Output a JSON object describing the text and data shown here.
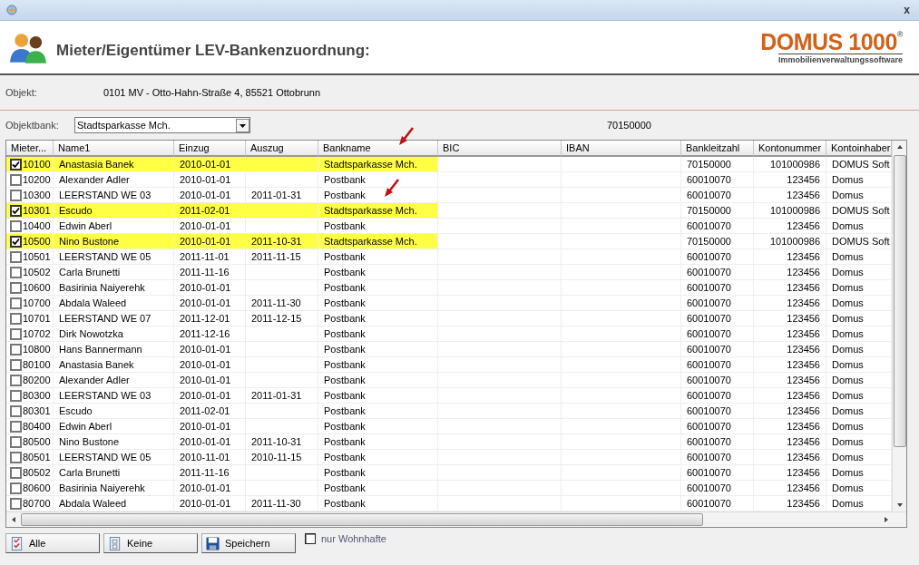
{
  "window": {
    "close": "x"
  },
  "header": {
    "title": "Mieter/Eigentümer LEV-Bankenzuordnung:",
    "logo": {
      "name": "DOMUS 1000",
      "mark": "®",
      "tagline": "Immobilienverwaltungssoftware"
    }
  },
  "objekt": {
    "label": "Objekt:",
    "value": "0101 MV - Otto-Hahn-Straße 4, 85521 Ottobrunn"
  },
  "objektbank": {
    "label": "Objektbank:",
    "value": "Stadtsparkasse Mch.",
    "bankleitzahl": "70150000"
  },
  "table": {
    "columns": [
      "Mieter...",
      "Name1",
      "Einzug",
      "Auszug",
      "Bankname",
      "BIC",
      "IBAN",
      "Bankleitzahl",
      "Kontonummer",
      "Kontoinhaber"
    ],
    "rows": [
      {
        "checked": true,
        "mieter": "10100",
        "name1": "Anastasia Banek",
        "einzug": "2010-01-01",
        "bankname": "Stadtsparkasse Mch.",
        "bankleitzahl": "70150000",
        "kontonummer": "101000986",
        "kontoinhaber": "DOMUS Soft"
      },
      {
        "checked": false,
        "mieter": "10200",
        "name1": "Alexander Adler",
        "einzug": "2010-01-01",
        "bankname": "Postbank",
        "bankleitzahl": "60010070",
        "kontonummer": "123456",
        "kontoinhaber": "Domus"
      },
      {
        "checked": false,
        "mieter": "10300",
        "name1": "LEERSTAND WE 03",
        "einzug": "2010-01-01",
        "auszug": "2011-01-31",
        "bankname": "Postbank",
        "bankleitzahl": "60010070",
        "kontonummer": "123456",
        "kontoinhaber": "Domus"
      },
      {
        "checked": true,
        "mieter": "10301",
        "name1": "Escudo",
        "einzug": "2011-02-01",
        "bankname": "Stadtsparkasse Mch.",
        "bankleitzahl": "70150000",
        "kontonummer": "101000986",
        "kontoinhaber": "DOMUS Soft"
      },
      {
        "checked": false,
        "mieter": "10400",
        "name1": "Edwin Aberl",
        "einzug": "2010-01-01",
        "bankname": "Postbank",
        "bankleitzahl": "60010070",
        "kontonummer": "123456",
        "kontoinhaber": "Domus"
      },
      {
        "checked": true,
        "mieter": "10500",
        "name1": "Nino Bustone",
        "einzug": "2010-01-01",
        "auszug": "2011-10-31",
        "bankname": "Stadtsparkasse Mch.",
        "bankleitzahl": "70150000",
        "kontonummer": "101000986",
        "kontoinhaber": "DOMUS Soft"
      },
      {
        "checked": false,
        "mieter": "10501",
        "name1": "LEERSTAND WE 05",
        "einzug": "2011-11-01",
        "auszug": "2011-11-15",
        "bankname": "Postbank",
        "bankleitzahl": "60010070",
        "kontonummer": "123456",
        "kontoinhaber": "Domus"
      },
      {
        "checked": false,
        "mieter": "10502",
        "name1": "Carla Brunetti",
        "einzug": "2011-11-16",
        "bankname": "Postbank",
        "bankleitzahl": "60010070",
        "kontonummer": "123456",
        "kontoinhaber": "Domus"
      },
      {
        "checked": false,
        "mieter": "10600",
        "name1": "Basirinia Naiyerehk",
        "einzug": "2010-01-01",
        "bankname": "Postbank",
        "bankleitzahl": "60010070",
        "kontonummer": "123456",
        "kontoinhaber": "Domus"
      },
      {
        "checked": false,
        "mieter": "10700",
        "name1": "Abdala Waleed",
        "einzug": "2010-01-01",
        "auszug": "2011-11-30",
        "bankname": "Postbank",
        "bankleitzahl": "60010070",
        "kontonummer": "123456",
        "kontoinhaber": "Domus"
      },
      {
        "checked": false,
        "mieter": "10701",
        "name1": "LEERSTAND WE 07",
        "einzug": "2011-12-01",
        "auszug": "2011-12-15",
        "bankname": "Postbank",
        "bankleitzahl": "60010070",
        "kontonummer": "123456",
        "kontoinhaber": "Domus"
      },
      {
        "checked": false,
        "mieter": "10702",
        "name1": "Dirk Nowotzka",
        "einzug": "2011-12-16",
        "bankname": "Postbank",
        "bankleitzahl": "60010070",
        "kontonummer": "123456",
        "kontoinhaber": "Domus"
      },
      {
        "checked": false,
        "mieter": "10800",
        "name1": "Hans Bannermann",
        "einzug": "2010-01-01",
        "bankname": "Postbank",
        "bankleitzahl": "60010070",
        "kontonummer": "123456",
        "kontoinhaber": "Domus"
      },
      {
        "checked": false,
        "mieter": "80100",
        "name1": "Anastasia Banek",
        "einzug": "2010-01-01",
        "bankname": "Postbank",
        "bankleitzahl": "60010070",
        "kontonummer": "123456",
        "kontoinhaber": "Domus"
      },
      {
        "checked": false,
        "mieter": "80200",
        "name1": "Alexander Adler",
        "einzug": "2010-01-01",
        "bankname": "Postbank",
        "bankleitzahl": "60010070",
        "kontonummer": "123456",
        "kontoinhaber": "Domus"
      },
      {
        "checked": false,
        "mieter": "80300",
        "name1": "LEERSTAND WE 03",
        "einzug": "2010-01-01",
        "auszug": "2011-01-31",
        "bankname": "Postbank",
        "bankleitzahl": "60010070",
        "kontonummer": "123456",
        "kontoinhaber": "Domus"
      },
      {
        "checked": false,
        "mieter": "80301",
        "name1": "Escudo",
        "einzug": "2011-02-01",
        "bankname": "Postbank",
        "bankleitzahl": "60010070",
        "kontonummer": "123456",
        "kontoinhaber": "Domus"
      },
      {
        "checked": false,
        "mieter": "80400",
        "name1": "Edwin Aberl",
        "einzug": "2010-01-01",
        "bankname": "Postbank",
        "bankleitzahl": "60010070",
        "kontonummer": "123456",
        "kontoinhaber": "Domus"
      },
      {
        "checked": false,
        "mieter": "80500",
        "name1": "Nino Bustone",
        "einzug": "2010-01-01",
        "auszug": "2011-10-31",
        "bankname": "Postbank",
        "bankleitzahl": "60010070",
        "kontonummer": "123456",
        "kontoinhaber": "Domus"
      },
      {
        "checked": false,
        "mieter": "80501",
        "name1": "LEERSTAND WE 05",
        "einzug": "2010-11-01",
        "auszug": "2010-11-15",
        "bankname": "Postbank",
        "bankleitzahl": "60010070",
        "kontonummer": "123456",
        "kontoinhaber": "Domus"
      },
      {
        "checked": false,
        "mieter": "80502",
        "name1": "Carla Brunetti",
        "einzug": "2011-11-16",
        "bankname": "Postbank",
        "bankleitzahl": "60010070",
        "kontonummer": "123456",
        "kontoinhaber": "Domus"
      },
      {
        "checked": false,
        "mieter": "80600",
        "name1": "Basirinia Naiyerehk",
        "einzug": "2010-01-01",
        "bankname": "Postbank",
        "bankleitzahl": "60010070",
        "kontonummer": "123456",
        "kontoinhaber": "Domus"
      },
      {
        "checked": false,
        "mieter": "80700",
        "name1": "Abdala Waleed",
        "einzug": "2010-01-01",
        "auszug": "2011-11-30",
        "bankname": "Postbank",
        "bankleitzahl": "60010070",
        "kontonummer": "123456",
        "kontoinhaber": "Domus"
      }
    ]
  },
  "buttons": [
    {
      "kind": "all",
      "label": "Alle"
    },
    {
      "kind": "none",
      "label": "Keine"
    },
    {
      "kind": "save",
      "label": "Speichern"
    }
  ],
  "filter": {
    "label": "nur Wohnhafte",
    "checked": false
  }
}
